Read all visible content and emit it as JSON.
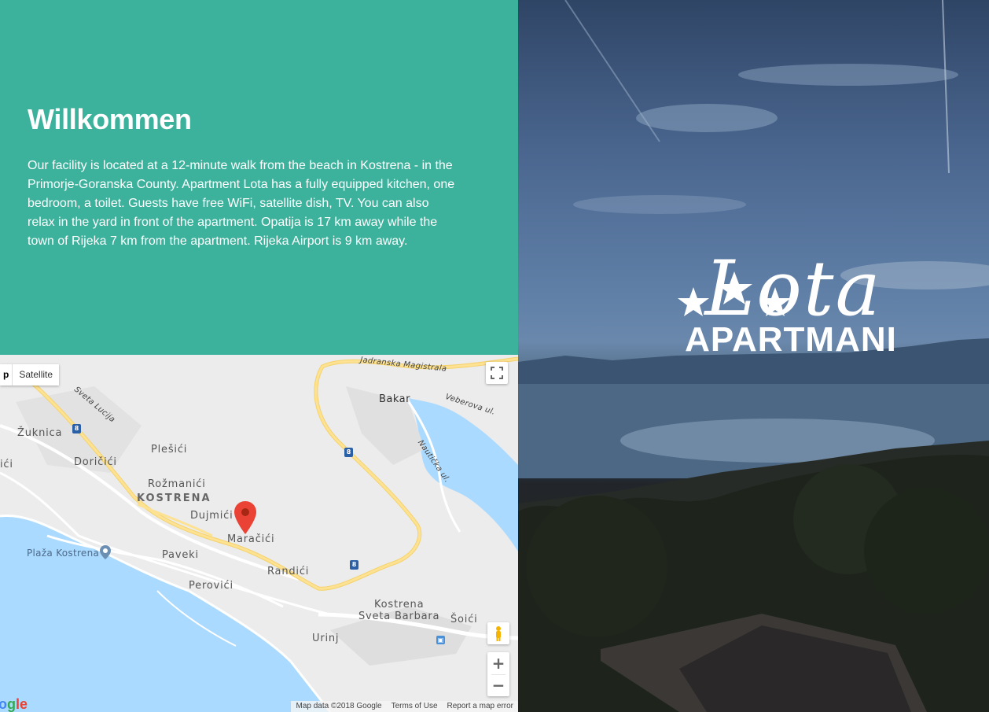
{
  "welcome": {
    "title": "Willkommen",
    "text": "Our facility is located at a 12-minute walk from the beach in Kostrena - in the Primorje-Goranska County. Apartment Lota has a fully equipped kitchen, one bedroom, a toilet. Guests have free WiFi, satellite dish, TV. You can also relax in the yard in front of the apartment. Opatija is 17 km away while the town of Rijeka 7 km from the apartment. Rijeka Airport is 9 km away."
  },
  "map": {
    "map_type_buttons": {
      "map": "p",
      "satellite": "Satellite"
    },
    "labels": {
      "jadranska": "Jadranska Magistrala",
      "bakar": "Bakar",
      "veberova": "Veberova ul.",
      "sveta_lucija": "Sveta Lucija",
      "zuknica": "Žuknica",
      "plesici": "Plešići",
      "dorcici": "Doričići",
      "ici": "ići",
      "rozmanici": "Rožmanići",
      "kostrena": "KOSTRENA",
      "dujmici": "Dujmići",
      "maracici": "Maračići",
      "nauticka": "Nautička ul.",
      "plaza": "Plaža Kostrena",
      "paveki": "Paveki",
      "randici": "Randići",
      "perovici": "Perovići",
      "kostrena_sb": "Kostrena",
      "sveta_barbara": "Sveta Barbara",
      "soici": "Šoići",
      "urinj": "Urinj"
    },
    "road_number": "8",
    "zoom_in": "+",
    "zoom_out": "−",
    "attribution": {
      "data": "Map data ©2018 Google",
      "terms": "Terms of Use",
      "report": "Report a map error"
    },
    "logo": {
      "part1": "o",
      "part2": "g",
      "part3": "le"
    }
  },
  "hero": {
    "logo_script": "Lota",
    "logo_brand": "APARTMANI"
  }
}
